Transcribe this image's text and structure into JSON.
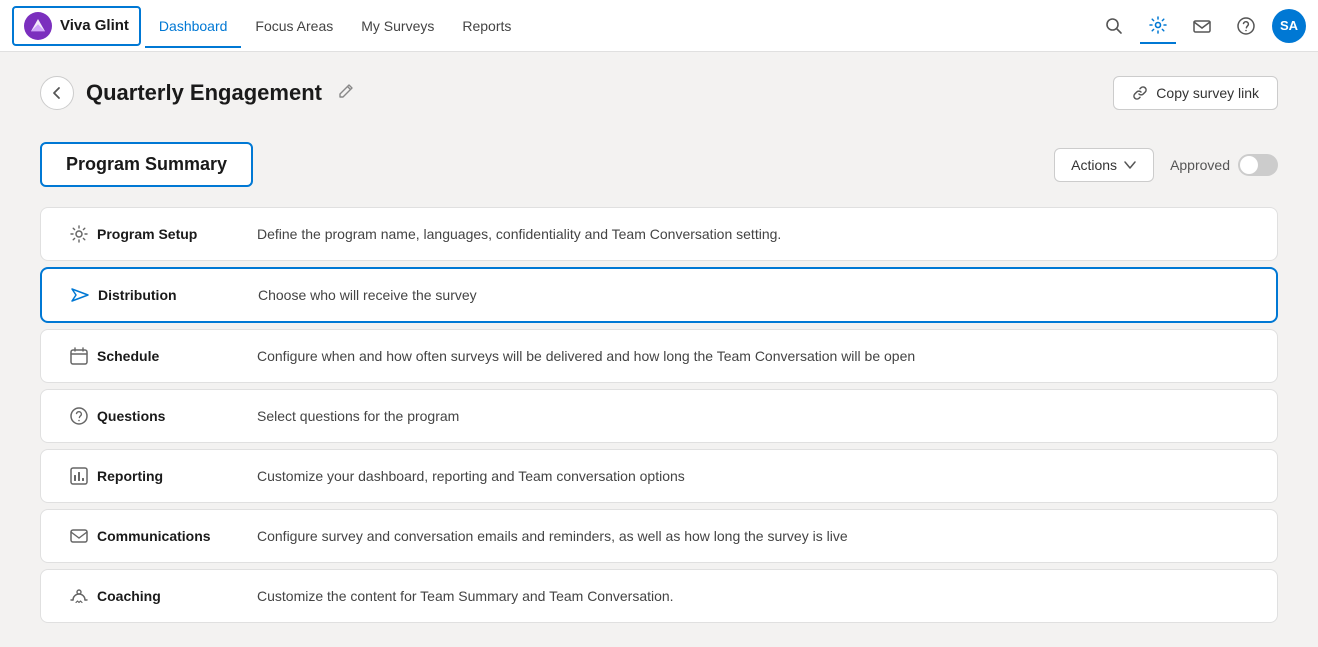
{
  "brand": {
    "name": "Viva Glint"
  },
  "nav": {
    "links": [
      {
        "id": "dashboard",
        "label": "Dashboard",
        "active": true
      },
      {
        "id": "focus-areas",
        "label": "Focus Areas",
        "active": false
      },
      {
        "id": "my-surveys",
        "label": "My Surveys",
        "active": false
      },
      {
        "id": "reports",
        "label": "Reports",
        "active": false
      }
    ],
    "icons": {
      "search": "🔍",
      "settings": "⚙️",
      "notifications": "✉️",
      "help": "❓"
    },
    "avatar": {
      "initials": "SA"
    }
  },
  "page": {
    "title": "Quarterly Engagement",
    "copy_button_label": "Copy survey link",
    "back_label": "Back"
  },
  "program_summary": {
    "section_title": "Program Summary",
    "actions_label": "Actions",
    "approved_label": "Approved",
    "items": [
      {
        "id": "program-setup",
        "icon": "gear",
        "title": "Program Setup",
        "description": "Define the program name, languages, confidentiality and Team Conversation setting.",
        "selected": false
      },
      {
        "id": "distribution",
        "icon": "send",
        "title": "Distribution",
        "description": "Choose who will receive the survey",
        "selected": true
      },
      {
        "id": "schedule",
        "icon": "calendar",
        "title": "Schedule",
        "description": "Configure when and how often surveys will be delivered and how long the Team Conversation will be open",
        "selected": false
      },
      {
        "id": "questions",
        "icon": "question",
        "title": "Questions",
        "description": "Select questions for the program",
        "selected": false
      },
      {
        "id": "reporting",
        "icon": "chart",
        "title": "Reporting",
        "description": "Customize your dashboard, reporting and Team conversation options",
        "selected": false
      },
      {
        "id": "communications",
        "icon": "email",
        "title": "Communications",
        "description": "Configure survey and conversation emails and reminders, as well as how long the survey is live",
        "selected": false
      },
      {
        "id": "coaching",
        "icon": "chat",
        "title": "Coaching",
        "description": "Customize the content for Team Summary and Team Conversation.",
        "selected": false
      }
    ]
  }
}
